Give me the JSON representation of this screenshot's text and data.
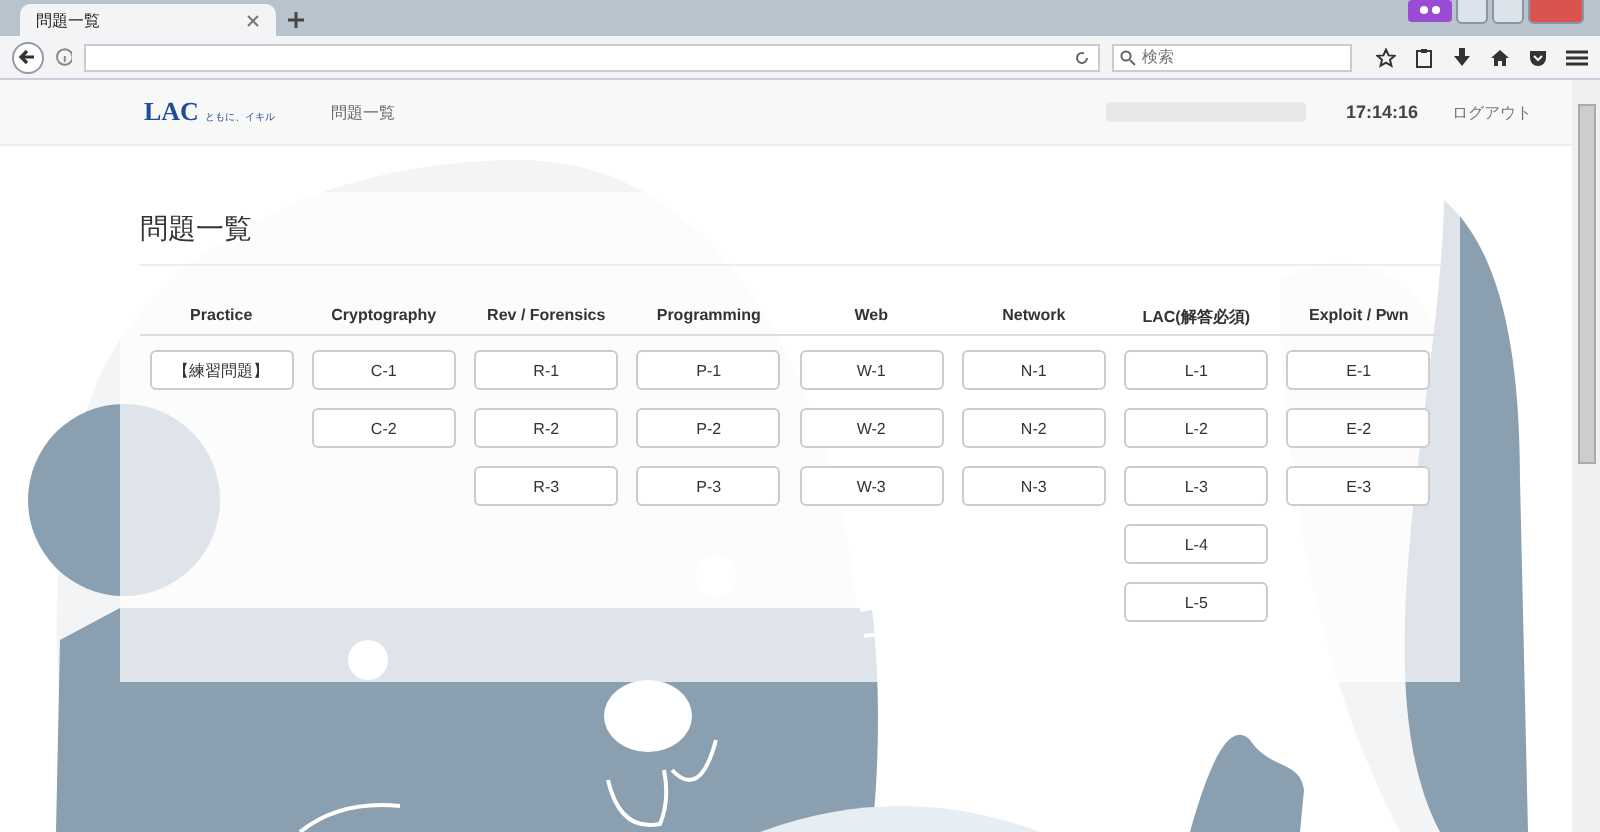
{
  "browser": {
    "tab_title": "問題一覧",
    "search_placeholder": "検索"
  },
  "header": {
    "logo": "LAC",
    "tagline": "ともに、イキル",
    "nav_link": "問題一覧",
    "time": "17:14:16",
    "logout": "ログアウト"
  },
  "page_title": "問題一覧",
  "columns": [
    {
      "heading": "Practice",
      "challenges": [
        "【練習問題】"
      ]
    },
    {
      "heading": "Cryptography",
      "challenges": [
        "C-1",
        "C-2"
      ]
    },
    {
      "heading": "Rev / Forensics",
      "challenges": [
        "R-1",
        "R-2",
        "R-3"
      ]
    },
    {
      "heading": "Programming",
      "challenges": [
        "P-1",
        "P-2",
        "P-3"
      ]
    },
    {
      "heading": "Web",
      "challenges": [
        "W-1",
        "W-2",
        "W-3"
      ]
    },
    {
      "heading": "Network",
      "challenges": [
        "N-1",
        "N-2",
        "N-3"
      ]
    },
    {
      "heading": "LAC(解答必須)",
      "challenges": [
        "L-1",
        "L-2",
        "L-3",
        "L-4",
        "L-5"
      ]
    },
    {
      "heading": "Exploit / Pwn",
      "challenges": [
        "E-1",
        "E-2",
        "E-3"
      ]
    }
  ]
}
